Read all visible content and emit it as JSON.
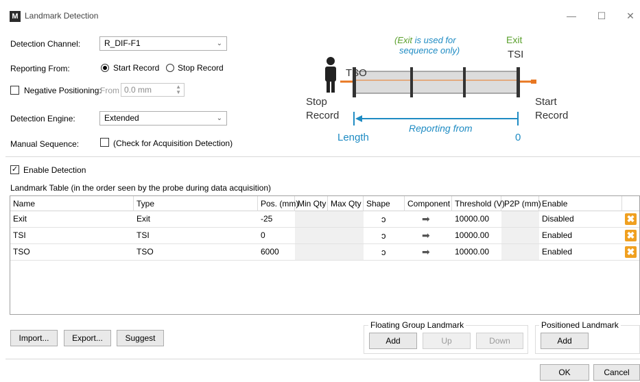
{
  "window": {
    "app_icon": "M",
    "title": "Landmark Detection",
    "minimize_icon": "minimize-icon",
    "maximize_icon": "maximize-icon",
    "close_icon": "close-icon"
  },
  "form": {
    "detection_channel_label": "Detection Channel:",
    "detection_channel_value": "R_DIF-F1",
    "reporting_from_label": "Reporting From:",
    "reporting_options": [
      "Start Record",
      "Stop Record"
    ],
    "reporting_selected": "Start Record",
    "negative_positioning_label": "Negative Positioning:",
    "negative_positioning_checked": false,
    "from_label": "From",
    "from_value": "0.0 mm",
    "detection_engine_label": "Detection Engine:",
    "detection_engine_value": "Extended",
    "manual_sequence_label": "Manual Sequence:",
    "manual_sequence_checkbox_label": "(Check for Acquisition Detection)",
    "manual_sequence_checked": false
  },
  "diagram": {
    "note_line1_italic": "(Exit",
    "note_line1_rest": " is used for",
    "note_line2": "sequence only)",
    "exit_label": "Exit",
    "tsi_label": "TSI",
    "tso_label": "TSO",
    "stop_record_line1": "Stop",
    "stop_record_line2": "Record",
    "start_record_line1": "Start",
    "start_record_line2": "Record",
    "reporting_from_label": "Reporting from",
    "length_label": "Length",
    "zero_label": "0",
    "colors": {
      "green": "#5aa02c",
      "blue": "#1e8bc3",
      "orange": "#e87722",
      "pipe": "#dcdcdc"
    }
  },
  "enable_detection": {
    "label": "Enable Detection",
    "checked": true
  },
  "table": {
    "caption": "Landmark Table (in the order seen by the probe during data acquisition)",
    "columns": [
      "Name",
      "Type",
      "Pos. (mm)",
      "Min Qty",
      "Max Qty",
      "Shape",
      "Component",
      "Threshold (V)",
      "P2P (mm)",
      "Enable"
    ],
    "rows": [
      {
        "name": "Exit",
        "type": "Exit",
        "pos": "-25",
        "shape": "ↄ",
        "component_icon": "arrow-right-icon",
        "component": "➡",
        "threshold": "10000.00",
        "enable": "Disabled",
        "delete": "✖"
      },
      {
        "name": "TSI",
        "type": "TSI",
        "pos": "0",
        "shape": "ↄ",
        "component_icon": "arrow-right-icon",
        "component": "➡",
        "threshold": "10000.00",
        "enable": "Enabled",
        "delete": "✖"
      },
      {
        "name": "TSO",
        "type": "TSO",
        "pos": "6000",
        "shape": "ↄ",
        "component_icon": "arrow-right-icon",
        "component": "➡",
        "threshold": "10000.00",
        "enable": "Enabled",
        "delete": "✖"
      }
    ]
  },
  "buttons": {
    "import": "Import...",
    "export": "Export...",
    "suggest": "Suggest",
    "floating_group_title": "Floating Group Landmark",
    "floating_add": "Add",
    "floating_up": "Up",
    "floating_down": "Down",
    "positioned_title": "Positioned Landmark",
    "positioned_add": "Add",
    "ok": "OK",
    "cancel": "Cancel"
  }
}
